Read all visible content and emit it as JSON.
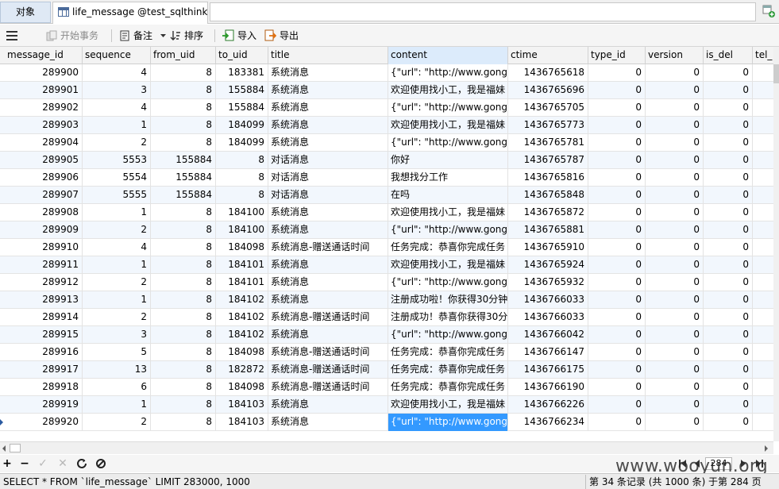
{
  "tabs": {
    "objects": "对象",
    "active": "life_message @test_sqlthink..."
  },
  "toolbar": {
    "begin_transaction": "开始事务",
    "memo": "备注",
    "sort": "排序",
    "import": "导入",
    "export": "导出"
  },
  "grid": {
    "columns": [
      "message_id",
      "sequence",
      "from_uid",
      "to_uid",
      "title",
      "content",
      "ctime",
      "type_id",
      "version",
      "is_del",
      "tel_"
    ],
    "rows": [
      [
        "289900",
        "4",
        "8",
        "183381",
        "系统消息",
        "{\"url\": \"http://www.gongre",
        "1436765618",
        "0",
        "0",
        "0"
      ],
      [
        "289901",
        "3",
        "8",
        "155884",
        "系统消息",
        "欢迎使用找小工，我是福妹",
        "1436765696",
        "0",
        "0",
        "0"
      ],
      [
        "289902",
        "4",
        "8",
        "155884",
        "系统消息",
        "{\"url\": \"http://www.gongre",
        "1436765705",
        "0",
        "0",
        "0"
      ],
      [
        "289903",
        "1",
        "8",
        "184099",
        "系统消息",
        "欢迎使用找小工，我是福妹",
        "1436765773",
        "0",
        "0",
        "0"
      ],
      [
        "289904",
        "2",
        "8",
        "184099",
        "系统消息",
        "{\"url\": \"http://www.gongre",
        "1436765781",
        "0",
        "0",
        "0"
      ],
      [
        "289905",
        "5553",
        "155884",
        "8",
        "对话消息",
        "你好",
        "1436765787",
        "0",
        "0",
        "0"
      ],
      [
        "289906",
        "5554",
        "155884",
        "8",
        "对话消息",
        "我想找分工作",
        "1436765816",
        "0",
        "0",
        "0"
      ],
      [
        "289907",
        "5555",
        "155884",
        "8",
        "对话消息",
        "在吗",
        "1436765848",
        "0",
        "0",
        "0"
      ],
      [
        "289908",
        "1",
        "8",
        "184100",
        "系统消息",
        "欢迎使用找小工，我是福妹",
        "1436765872",
        "0",
        "0",
        "0"
      ],
      [
        "289909",
        "2",
        "8",
        "184100",
        "系统消息",
        "{\"url\": \"http://www.gongre",
        "1436765881",
        "0",
        "0",
        "0"
      ],
      [
        "289910",
        "4",
        "8",
        "184098",
        "系统消息-赠送通话时间",
        "任务完成：恭喜你完成任务",
        "1436765910",
        "0",
        "0",
        "0"
      ],
      [
        "289911",
        "1",
        "8",
        "184101",
        "系统消息",
        "欢迎使用找小工，我是福妹",
        "1436765924",
        "0",
        "0",
        "0"
      ],
      [
        "289912",
        "2",
        "8",
        "184101",
        "系统消息",
        "{\"url\": \"http://www.gongre",
        "1436765932",
        "0",
        "0",
        "0"
      ],
      [
        "289913",
        "1",
        "8",
        "184102",
        "系统消息",
        "注册成功啦！你获得30分钟",
        "1436766033",
        "0",
        "0",
        "0"
      ],
      [
        "289914",
        "2",
        "8",
        "184102",
        "系统消息-赠送通话时间",
        "注册成功！恭喜你获得30分",
        "1436766033",
        "0",
        "0",
        "0"
      ],
      [
        "289915",
        "3",
        "8",
        "184102",
        "系统消息",
        "{\"url\": \"http://www.gongre",
        "1436766042",
        "0",
        "0",
        "0"
      ],
      [
        "289916",
        "5",
        "8",
        "184098",
        "系统消息-赠送通话时间",
        "任务完成：恭喜你完成任务",
        "1436766147",
        "0",
        "0",
        "0"
      ],
      [
        "289917",
        "13",
        "8",
        "182872",
        "系统消息-赠送通话时间",
        "任务完成：恭喜你完成任务",
        "1436766175",
        "0",
        "0",
        "0"
      ],
      [
        "289918",
        "6",
        "8",
        "184098",
        "系统消息-赠送通话时间",
        "任务完成：恭喜你完成任务",
        "1436766190",
        "0",
        "0",
        "0"
      ],
      [
        "289919",
        "1",
        "8",
        "184103",
        "系统消息",
        "欢迎使用找小工，我是福妹",
        "1436766226",
        "0",
        "0",
        "0"
      ],
      [
        "289920",
        "2",
        "8",
        "184103",
        "系统消息",
        "{\"url\": \"http://www.gongre",
        "1436766234",
        "0",
        "0",
        "0"
      ]
    ],
    "selected_row": 20,
    "selected_column": 5
  },
  "navbar": {
    "page": "284"
  },
  "watermark": "www.wooyun.org",
  "status": {
    "sql": "SELECT * FROM `life_message` LIMIT 283000, 1000",
    "record_info": "第 34 条记录 (共 1000 条) 于第 284 页"
  },
  "colors": {
    "selection": "#3399ff",
    "alt_row": "#f2f7fd",
    "active_header": "#dcebfb"
  }
}
